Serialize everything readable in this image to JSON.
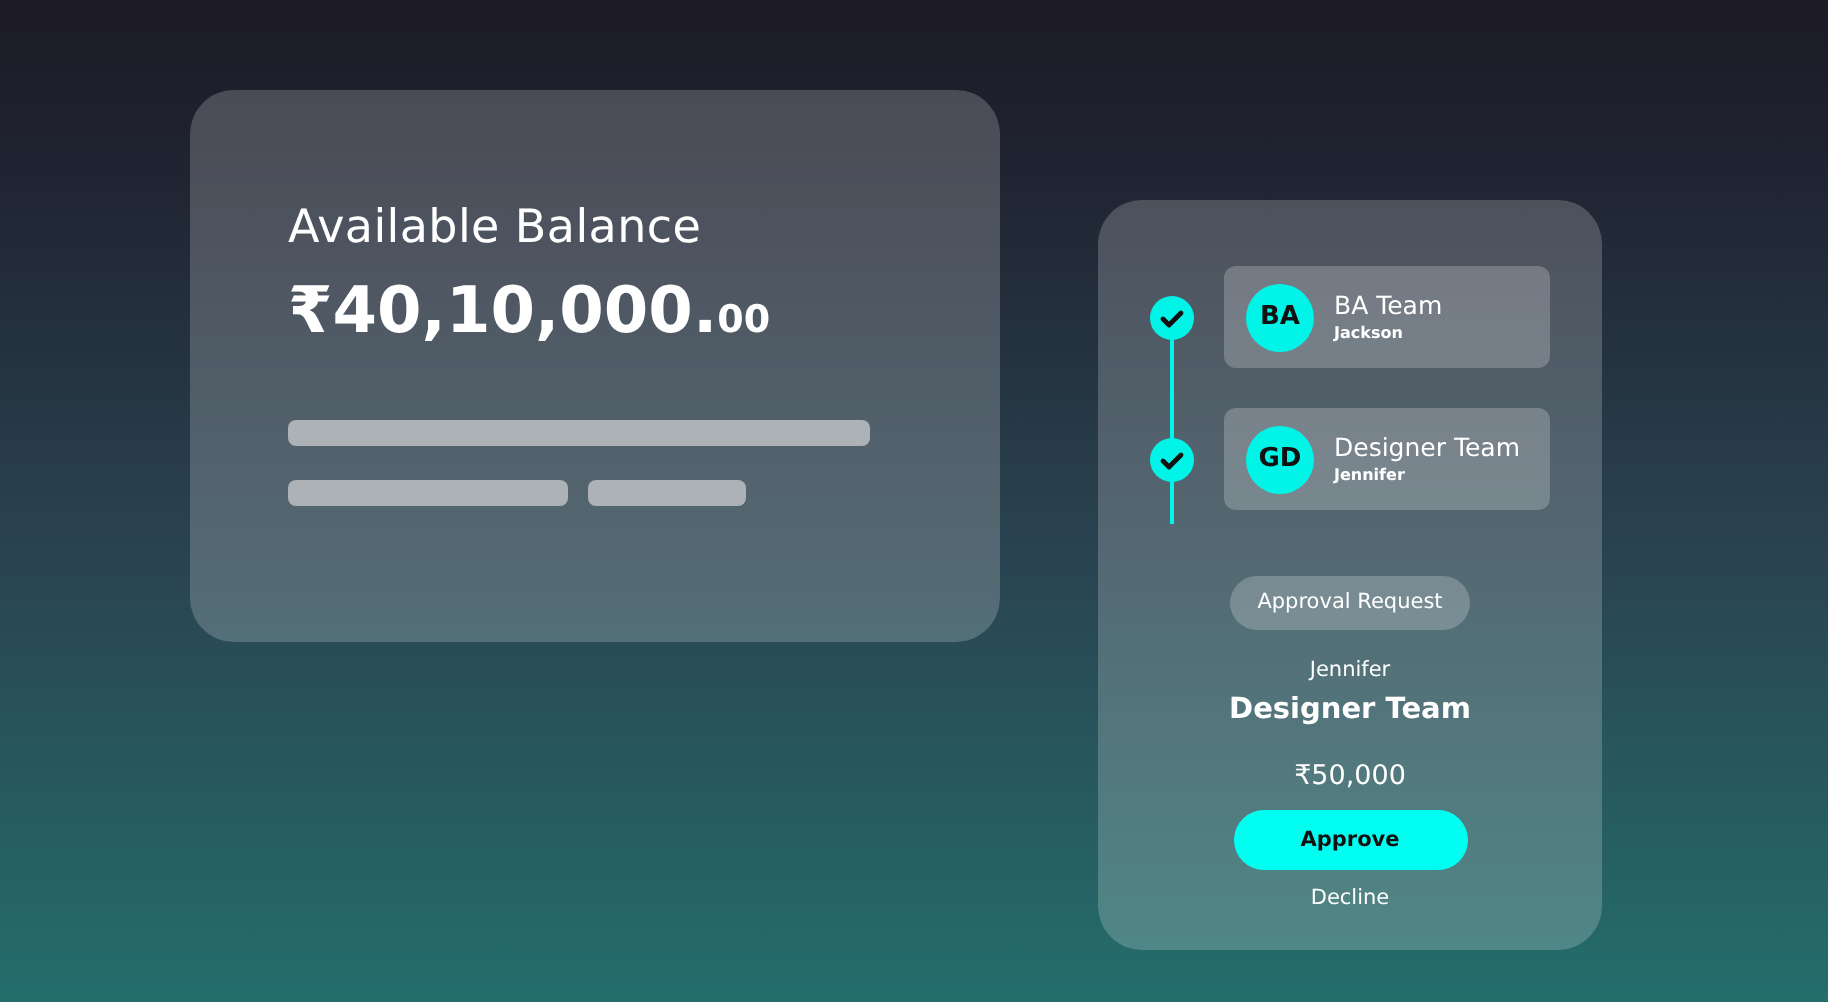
{
  "balance_card": {
    "title": "Available Balance",
    "amount": "₹40,10,000.",
    "decimals": "00"
  },
  "approval_card": {
    "steps": [
      {
        "initials": "BA",
        "team": "BA Team",
        "person": "Jackson",
        "done": true
      },
      {
        "initials": "GD",
        "team": "Designer Team",
        "person": "Jennifer",
        "done": true
      }
    ],
    "tag": "Approval Request",
    "requester": "Jennifer",
    "team": "Designer Team",
    "amount": "₹50,000",
    "approve": "Approve",
    "decline": "Decline"
  }
}
